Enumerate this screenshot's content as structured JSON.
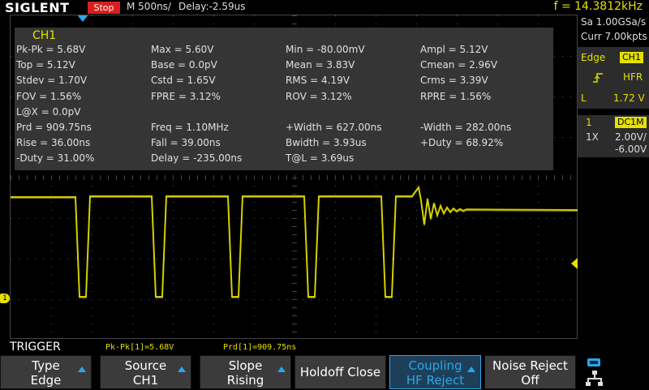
{
  "topbar": {
    "brand": "SIGLENT",
    "run_state": "Stop",
    "timebase": "M 500ns/",
    "delay": "Delay:-2.59us",
    "frequency": "f = 14.3812kHz"
  },
  "measurements": {
    "channel": "CH1",
    "rows": [
      [
        "Pk-Pk = 5.68V",
        "Max = 5.60V",
        "Min = -80.00mV",
        "Ampl = 5.12V"
      ],
      [
        "Top = 5.12V",
        "Base = 0.0pV",
        "Mean = 3.83V",
        "Cmean = 2.96V"
      ],
      [
        "Stdev = 1.70V",
        "Cstd = 1.65V",
        "RMS = 4.19V",
        "Crms = 3.39V"
      ],
      [
        "FOV = 1.56%",
        "FPRE = 3.12%",
        "ROV = 3.12%",
        "RPRE = 1.56%"
      ],
      [
        "L@X = 0.0pV",
        "",
        "",
        ""
      ],
      [
        "Prd = 909.75ns",
        "Freq = 1.10MHz",
        "+Width = 627.00ns",
        "-Width = 282.00ns"
      ],
      [
        "Rise = 36.00ns",
        "Fall = 39.00ns",
        "Bwidth = 3.93us",
        "+Duty = 68.92%"
      ],
      [
        "-Duty = 31.00%",
        "Delay = -235.00ns",
        "T@L = 3.69us",
        ""
      ]
    ]
  },
  "right_panel": {
    "sample_rate": "Sa 1.00GSa/s",
    "memory_depth": "Curr 7.00kpts",
    "trigger_type": "Edge",
    "trigger_source": "CH1",
    "trigger_coupling": "HFR",
    "level_label": "L",
    "trigger_level": "1.72 V",
    "channel_number": "1",
    "channel_coupling": "DC1M",
    "probe": "1X",
    "volts_per_div": "2.00V/",
    "offset": "-6.00V"
  },
  "channel_marker": "1",
  "bottom": {
    "menu_title": "TRIGGER",
    "stat_pkpk": "Pk-Pk[1]=5.68V",
    "stat_prd": "Prd[1]=909.75ns",
    "softkeys": [
      {
        "line1": "Type",
        "line2": "Edge"
      },
      {
        "line1": "Source",
        "line2": "CH1"
      },
      {
        "line1": "Slope",
        "line2": "Rising"
      },
      {
        "line1": "Holdoff Close",
        "line2": ""
      },
      {
        "line1": "Coupling",
        "line2": "HF Reject"
      },
      {
        "line1": "Noise Reject",
        "line2": "Off"
      }
    ]
  },
  "colors": {
    "trace": "#e5e000",
    "accent": "#2aa7e8",
    "stop": "#d81e1e"
  }
}
